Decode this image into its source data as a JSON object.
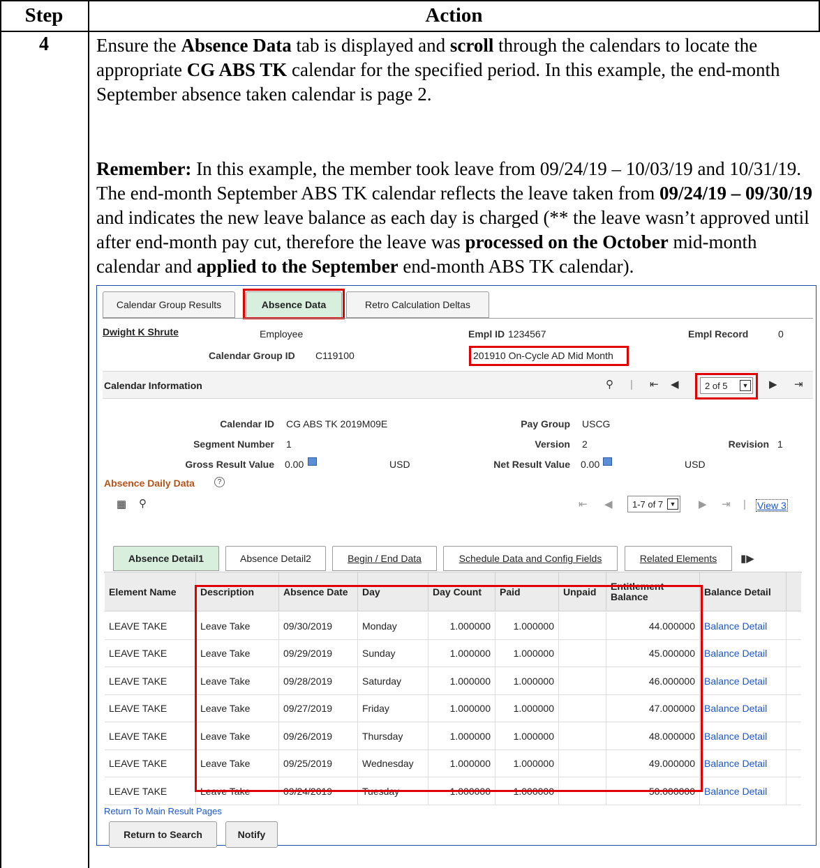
{
  "doc": {
    "header_step": "Step",
    "header_action": "Action",
    "step_number": "4",
    "p1": [
      {
        "t": "Ensure the ",
        "b": false
      },
      {
        "t": "Absence Data",
        "b": true
      },
      {
        "t": " tab is displayed and ",
        "b": false
      },
      {
        "t": "scroll",
        "b": true
      },
      {
        "t": " through the calendars to locate the appropriate ",
        "b": false
      },
      {
        "t": "CG ABS TK",
        "b": true
      },
      {
        "t": " calendar for the specified period.  In this example, the end-month September absence taken calendar is page 2.",
        "b": false
      }
    ],
    "p2": [
      {
        "t": "Remember:",
        "b": true
      },
      {
        "t": "  In this example, the member took leave from 09/24/19 – 10/03/19 and 10/31/19.  The end-month September ABS TK calendar reflects the leave taken from ",
        "b": false
      },
      {
        "t": "09/24/19 – 09/30/19",
        "b": true
      },
      {
        "t": " and indicates the new leave balance as each day is charged (** the leave wasn’t approved until after end-month pay cut, therefore the leave was ",
        "b": false
      },
      {
        "t": "processed on the October",
        "b": true
      },
      {
        "t": " mid-month calendar and ",
        "b": false
      },
      {
        "t": "applied to the September",
        "b": true
      },
      {
        "t": " end-month ABS TK calendar).",
        "b": false
      }
    ]
  },
  "screen": {
    "tabs": [
      "Calendar Group Results",
      "Absence Data",
      "Retro Calculation Deltas"
    ],
    "employee_name": "Dwight K Shrute",
    "employee_role": "Employee",
    "empl_id_label": "Empl ID",
    "empl_id_value": "1234567",
    "empl_record_label": "Empl Record",
    "empl_record_value": "0",
    "calendar_group_id_label": "Calendar Group ID",
    "calendar_group_id_value": "C119100",
    "calendar_group_desc": "201910 On-Cycle AD Mid Month",
    "calendar_info_title": "Calendar Information",
    "calendar_pager": "2 of 5",
    "calendar_id_label": "Calendar ID",
    "calendar_id_value": "CG ABS TK 2019M09E",
    "pay_group_label": "Pay Group",
    "pay_group_value": "USCG",
    "segment_number_label": "Segment Number",
    "segment_number_value": "1",
    "version_label": "Version",
    "version_value": "2",
    "revision_label": "Revision",
    "revision_value": "1",
    "gross_result_label": "Gross Result Value",
    "gross_result_value": "0.00",
    "gross_currency": "USD",
    "net_result_label": "Net Result Value",
    "net_result_value": "0.00",
    "net_currency": "USD",
    "absence_daily_title": "Absence Daily Data",
    "grid_pager": "1-7 of 7",
    "view_link": "View 3",
    "subtabs": [
      "Absence Detail1",
      "Absence Detail2",
      "Begin / End Data",
      "Schedule Data and Config Fields",
      "Related Elements"
    ],
    "columns": [
      "Element Name",
      "Description",
      "Absence Date",
      "Day",
      "Day Count",
      "Paid",
      "Unpaid",
      "Entitlement Balance",
      "Balance Detail"
    ],
    "rows": [
      {
        "element": "LEAVE TAKE",
        "desc": "Leave Take",
        "date": "09/30/2019",
        "day": "Monday",
        "count": "1.000000",
        "paid": "1.000000",
        "unpaid": "",
        "balance": "44.000000",
        "detail": "Balance Detail"
      },
      {
        "element": "LEAVE TAKE",
        "desc": "Leave Take",
        "date": "09/29/2019",
        "day": "Sunday",
        "count": "1.000000",
        "paid": "1.000000",
        "unpaid": "",
        "balance": "45.000000",
        "detail": "Balance Detail"
      },
      {
        "element": "LEAVE TAKE",
        "desc": "Leave Take",
        "date": "09/28/2019",
        "day": "Saturday",
        "count": "1.000000",
        "paid": "1.000000",
        "unpaid": "",
        "balance": "46.000000",
        "detail": "Balance Detail"
      },
      {
        "element": "LEAVE TAKE",
        "desc": "Leave Take",
        "date": "09/27/2019",
        "day": "Friday",
        "count": "1.000000",
        "paid": "1.000000",
        "unpaid": "",
        "balance": "47.000000",
        "detail": "Balance Detail"
      },
      {
        "element": "LEAVE TAKE",
        "desc": "Leave Take",
        "date": "09/26/2019",
        "day": "Thursday",
        "count": "1.000000",
        "paid": "1.000000",
        "unpaid": "",
        "balance": "48.000000",
        "detail": "Balance Detail"
      },
      {
        "element": "LEAVE TAKE",
        "desc": "Leave Take",
        "date": "09/25/2019",
        "day": "Wednesday",
        "count": "1.000000",
        "paid": "1.000000",
        "unpaid": "",
        "balance": "49.000000",
        "detail": "Balance Detail"
      },
      {
        "element": "LEAVE TAKE",
        "desc": "Leave Take",
        "date": "09/24/2019",
        "day": "Tuesday",
        "count": "1.000000",
        "paid": "1.000000",
        "unpaid": "",
        "balance": "50.000000",
        "detail": "Balance Detail"
      }
    ],
    "return_link": "Return To Main Result Pages",
    "return_search_btn": "Return to Search",
    "notify_btn": "Notify"
  }
}
